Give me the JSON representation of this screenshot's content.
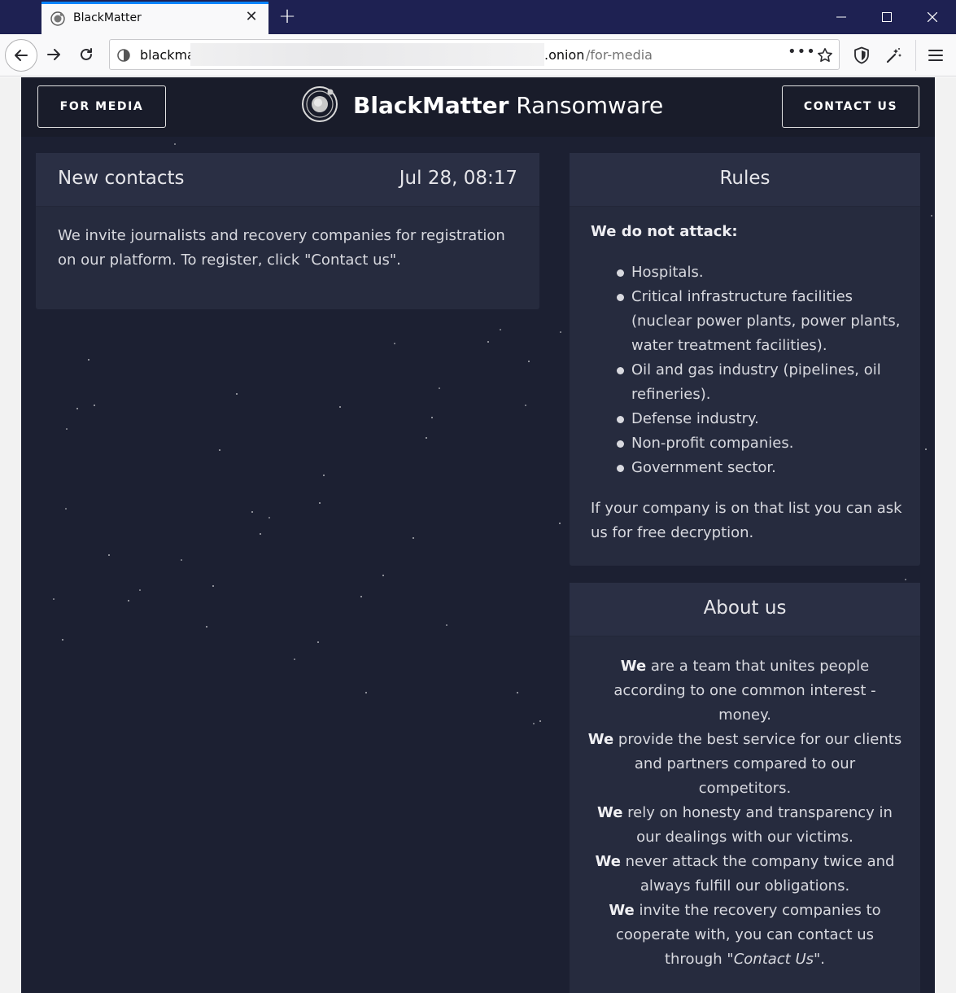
{
  "browser": {
    "tab_title": "BlackMatter",
    "url_host": "blackma",
    "url_tld": ".onion",
    "url_path": "/for-media",
    "url_more": "•••"
  },
  "header": {
    "for_media_label": "FOR MEDIA",
    "logo_bold": "BlackMatter",
    "logo_regular": " Ransomware",
    "contact_label": "CONTACT US"
  },
  "news": {
    "title": "New contacts",
    "date": "Jul 28, 08:17",
    "body": "We invite journalists and recovery companies for registration on our platform. To register, click \"Contact us\"."
  },
  "rules": {
    "title": "Rules",
    "intro": "We do not attack:",
    "items": [
      "Hospitals.",
      "Critical infrastructure facilities (nuclear power plants, power plants, water treatment facilities).",
      "Oil and gas industry (pipelines, oil refineries).",
      "Defense industry.",
      "Non-profit companies.",
      "Government sector."
    ],
    "note": "If your company is on that list you can ask us for free decryption."
  },
  "about": {
    "title": "About us",
    "we": "We",
    "p1": " are a team that unites people according to one common interest - money.",
    "p2": " provide the best service for our clients and partners compared to our competitors.",
    "p3": " rely on honesty and transparency in our dealings with our victims.",
    "p4": " never attack the company twice and always fulfill our obligations.",
    "p5": " invite the recovery companies to cooperate with, you can contact us through \"",
    "p5_link": "Contact Us",
    "p5_end": "\"."
  },
  "colors": {
    "page_bg": "#1c2032",
    "header_bg": "#191c2a",
    "card_bg": "#262b3e",
    "titlebar": "#1e2152",
    "tab_accent": "#0a84ff"
  }
}
